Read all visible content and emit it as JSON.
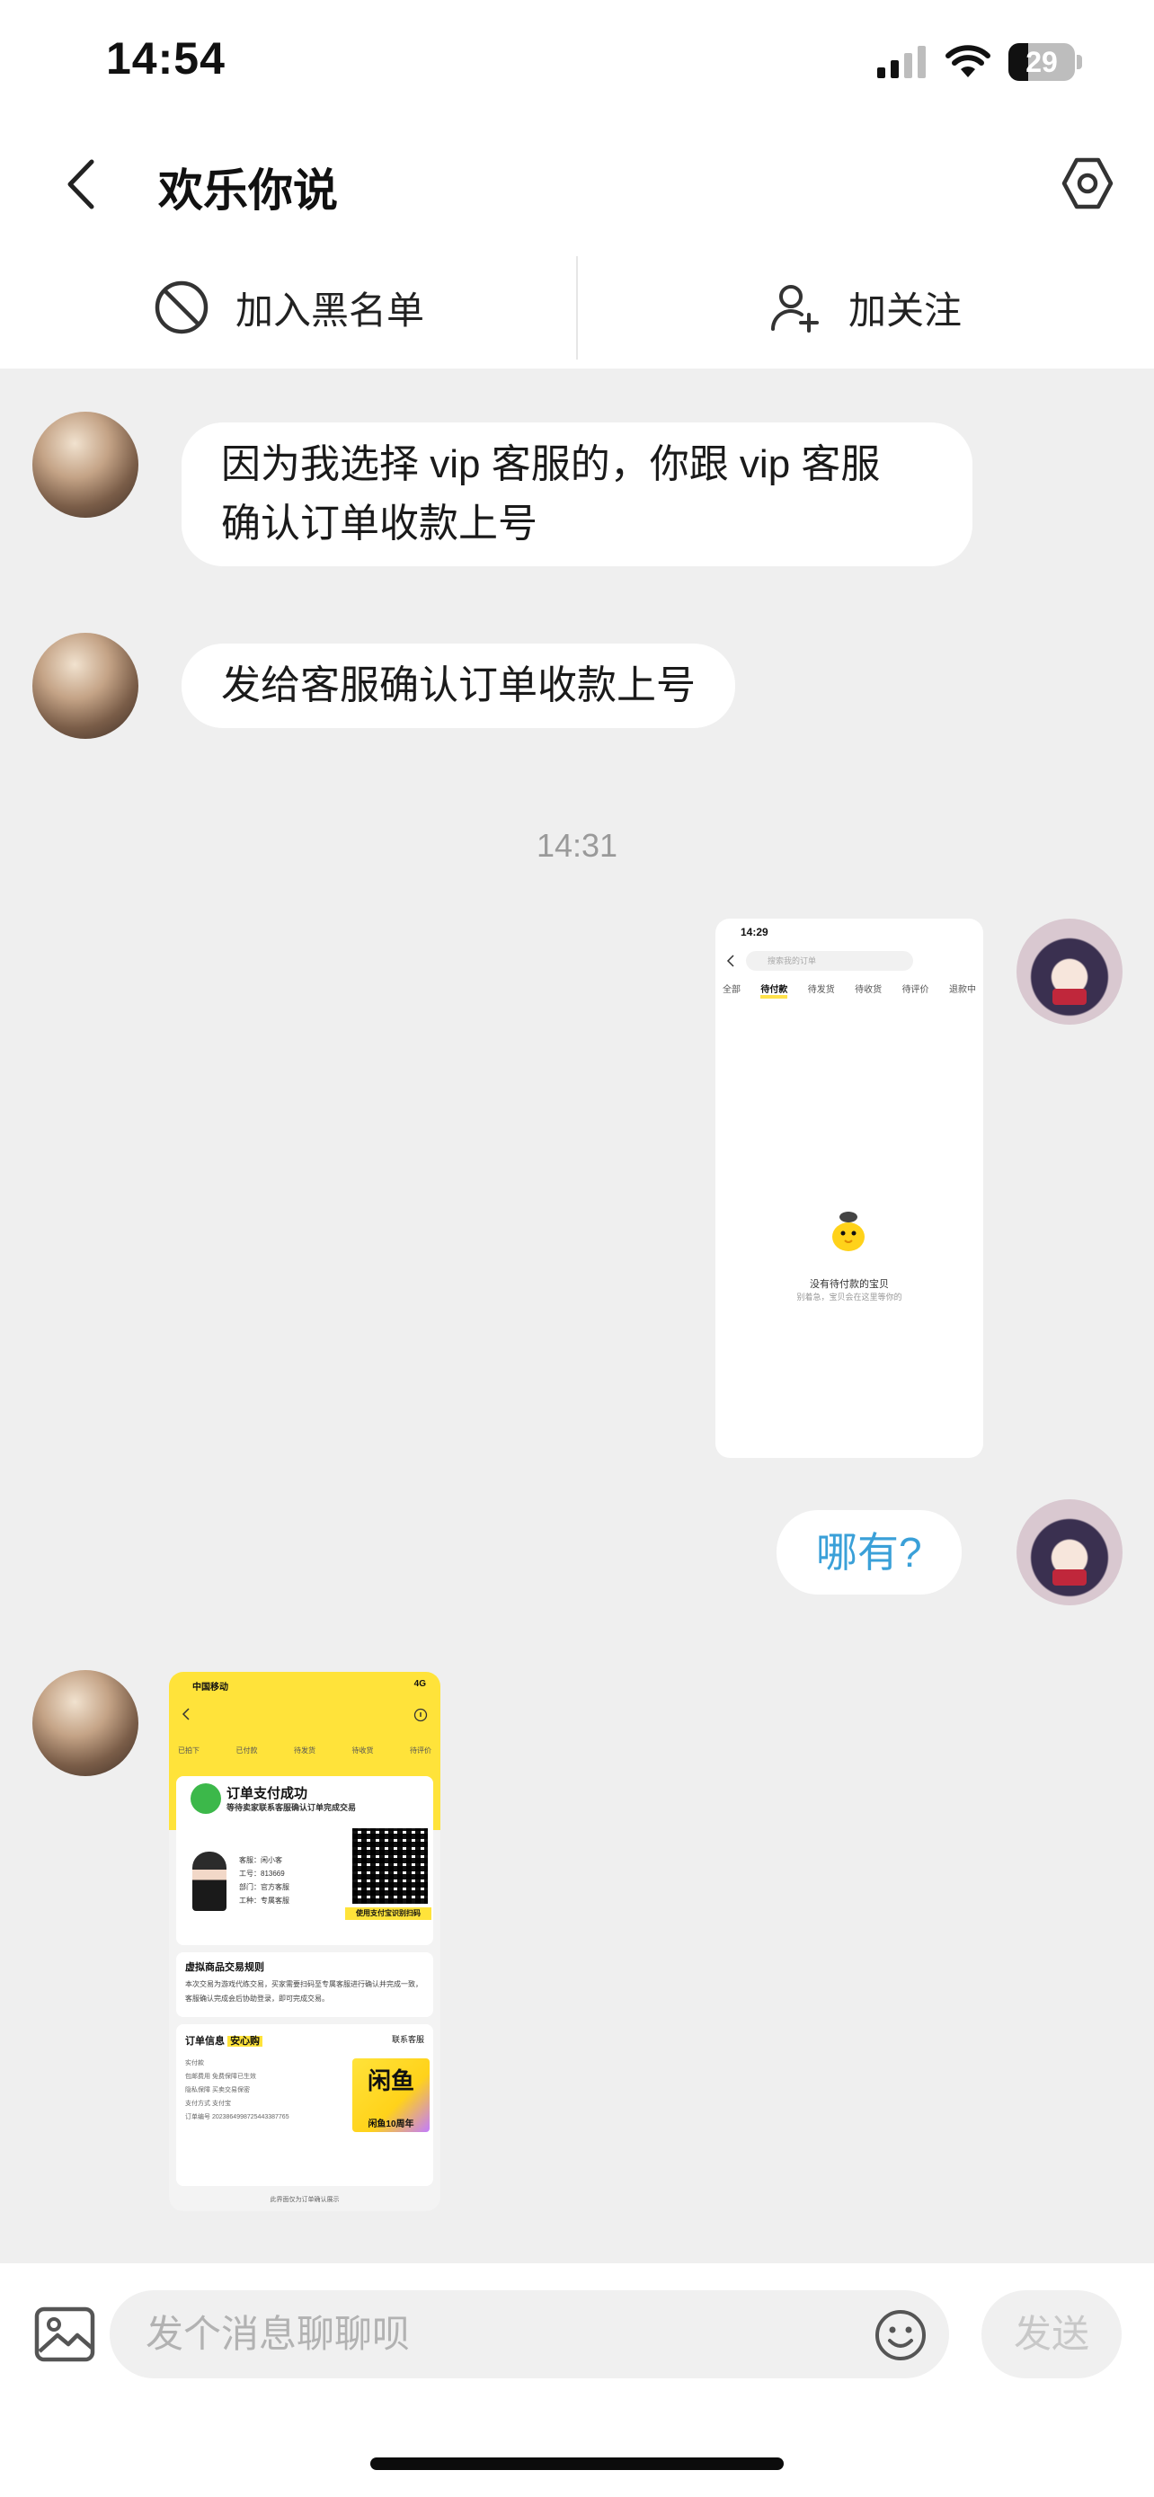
{
  "status_bar": {
    "time": "14:54",
    "battery": "29"
  },
  "nav": {
    "title": "欢乐你说"
  },
  "actions": {
    "block_label": "加入黑名单",
    "follow_label": "加关注"
  },
  "messages": [
    {
      "side": "left",
      "text_line1": "因为我选择 vip 客服的，你跟 vip 客服",
      "text_line2": "确认订单收款上号"
    },
    {
      "side": "left",
      "text": "发给客服确认订单收款上号"
    },
    {
      "timestamp": "14:31"
    },
    {
      "side": "right",
      "type": "image",
      "content": "screenshot"
    },
    {
      "side": "right",
      "text": "哪有?"
    },
    {
      "side": "left",
      "type": "image",
      "content": "screenshot"
    }
  ],
  "shot1": {
    "time": "14:29",
    "search_placeholder": "搜索我的订单",
    "tabs": [
      "全部",
      "待付款",
      "待发货",
      "待收货",
      "待评价",
      "退款中"
    ],
    "empty": "没有待付款的宝贝",
    "empty_sub": "别着急，宝贝会在这里等你的"
  },
  "shot2": {
    "carrier": "中国移动",
    "signal": "4G",
    "steps": [
      "已拍下",
      "已付款",
      "待发货",
      "待收货",
      "待评价"
    ],
    "success_title": "订单支付成功",
    "success_sub": "等待卖家联系客服确认订单完成交易",
    "qr_label": "使用支付宝识别扫码",
    "info_lines": [
      "客服：闲小客",
      "工号：813669",
      "部门：官方客服",
      "工种：专属客服"
    ],
    "rules_title": "虚拟商品交易规则",
    "rules_body": "本次交易为游戏代练交易，买家需要扫码至专属客服进行确认并完成一致，客服确认完成会后协助登录，即可完成交易。",
    "order_title": "订单信息",
    "order_tag": "安心购",
    "order_contact": "联系客服",
    "order_lines": [
      "实付款",
      "包邮费用 免费保障已生效",
      "隐私保障 买卖交易保密",
      "支付方式 支付宝",
      "订单编号 2023864998725443387765"
    ],
    "anniv_text": "闲鱼",
    "anniv_sub": "闲鱼10周年",
    "footer": "此界面仅为订单确认展示"
  },
  "composer": {
    "placeholder": "发个消息聊聊呗",
    "send_label": "发送"
  }
}
